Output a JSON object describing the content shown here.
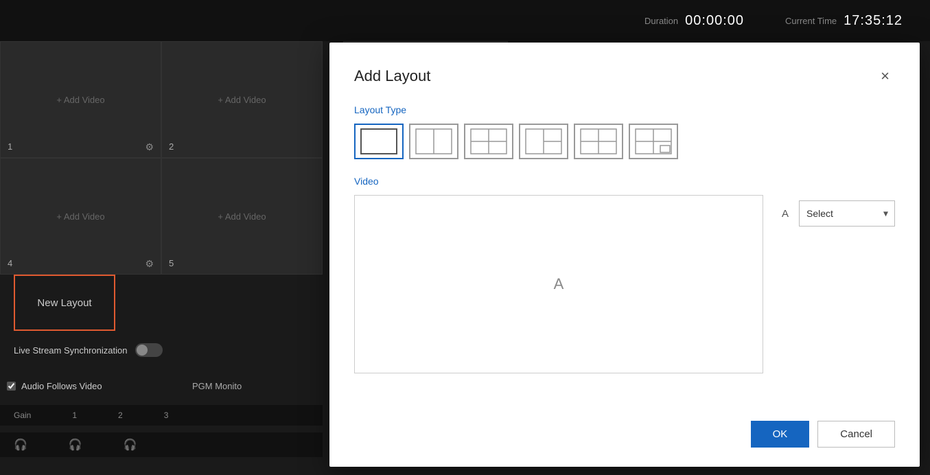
{
  "topbar": {
    "duration_label": "Duration",
    "duration_value": "00:00:00",
    "current_time_label": "Current Time",
    "current_time_value": "17:35:12"
  },
  "video_cells": [
    {
      "id": "1",
      "add_label": "+ Add Video"
    },
    {
      "id": "2",
      "add_label": "+ Add Video"
    },
    {
      "id": "4",
      "add_label": "+ Add Video"
    },
    {
      "id": "5",
      "add_label": "+ Add Video"
    }
  ],
  "new_layout_btn": "New Layout",
  "live_stream_label": "Live Stream Synchronization",
  "audio_follows_video_label": "Audio Follows Video",
  "pgm_monitor_label": "PGM Monito",
  "gain_label": "Gain",
  "gain_channels": [
    "1",
    "2",
    "3"
  ],
  "modal": {
    "title": "Add Layout",
    "close_icon": "×",
    "layout_type_label": "Layout Type",
    "video_label": "Video",
    "video_preview_letter": "A",
    "selector_letter": "A",
    "selector_placeholder": "Select",
    "ok_label": "OK",
    "cancel_label": "Cancel",
    "layout_types": [
      {
        "id": "single",
        "label": "Single"
      },
      {
        "id": "split2v",
        "label": "Split 2 Vertical"
      },
      {
        "id": "split2h",
        "label": "Split 2 Horizontal"
      },
      {
        "id": "split3",
        "label": "Split 3"
      },
      {
        "id": "split4",
        "label": "Split 4"
      },
      {
        "id": "split4pip",
        "label": "Split 4 PiP"
      }
    ]
  }
}
